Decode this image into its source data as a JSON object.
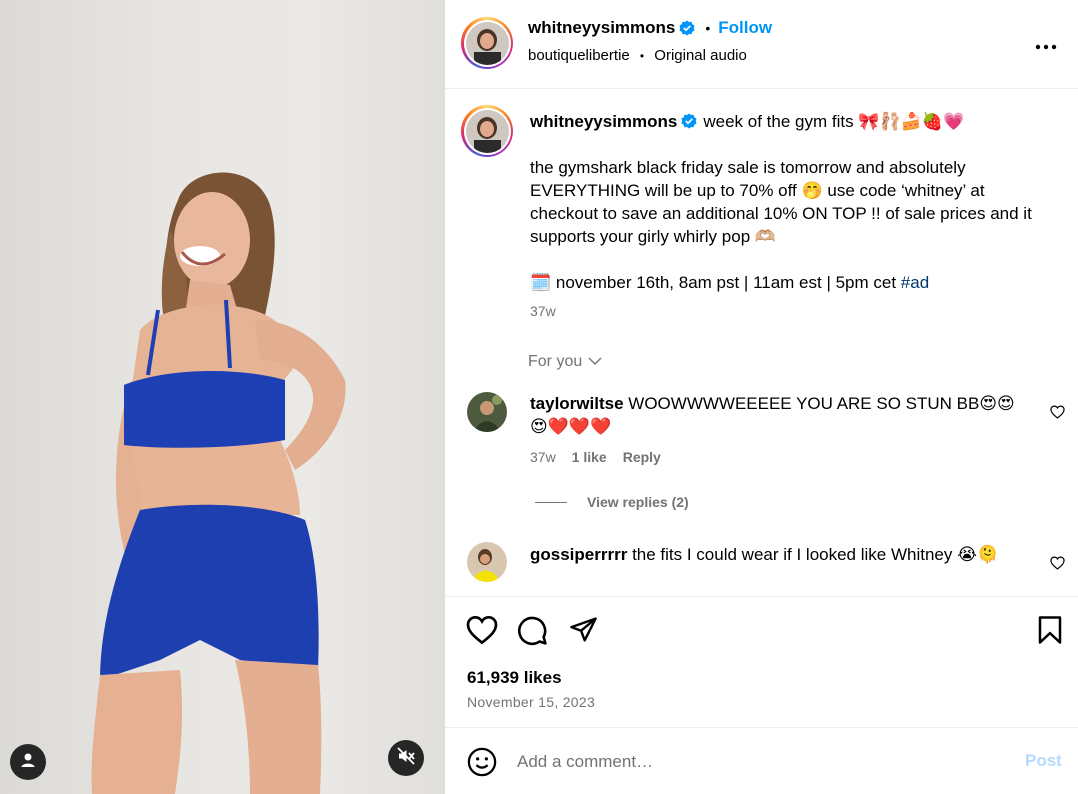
{
  "post": {
    "username": "whitneyysimmons",
    "verified": true,
    "follow_label": "Follow",
    "separator": "•",
    "audio_owner": "boutiquelibertie",
    "audio_label": "Original audio",
    "more_label": "•••"
  },
  "caption": {
    "username": "whitneyysimmons",
    "title": "week of the gym fits 🎀🩰🍰🍓💗",
    "paragraph": "the gymshark black friday sale is tomorrow and absolutely EVERYTHING will be up to 70% off 🤭 use code ‘whitney’ at checkout to save an additional 10% ON TOP !! of sale prices and it supports your girly whirly pop 🫶🏼",
    "schedule": "🗓️ november 16th, 8am pst | 11am est | 5pm cet ",
    "hashtag": "#ad",
    "time": "37w"
  },
  "comments_filter": {
    "label": "For you"
  },
  "comments": [
    {
      "username": "taylorwiltse",
      "text": "WOOWWWWEEEEE YOU ARE SO STUN BB😍😍😍❤️❤️❤️",
      "time": "37w",
      "likes": "1 like",
      "reply_label": "Reply",
      "view_replies": "View replies (2)"
    },
    {
      "username": "gossiperrrrr",
      "text": "the fits I could wear if I looked like Whitney 😭🫠"
    }
  ],
  "stats": {
    "likes": "61,939 likes",
    "date": "November 15, 2023"
  },
  "composer": {
    "placeholder": "Add a comment…",
    "post_label": "Post"
  },
  "icons": {
    "verified": "verified-badge-icon",
    "more": "more-options-icon",
    "chevron": "chevron-down-icon",
    "like": "heart-icon",
    "comment": "comment-icon",
    "share": "share-icon",
    "save": "bookmark-icon",
    "emoji": "emoji-icon",
    "user": "user-icon",
    "mute": "muted-speaker-icon"
  },
  "colors": {
    "accent": "#0095f6",
    "secondary_text": "#737373",
    "hashtag": "#00376b",
    "post_disabled": "#b3dbff",
    "outfit_blue": "#1e3fb0"
  }
}
